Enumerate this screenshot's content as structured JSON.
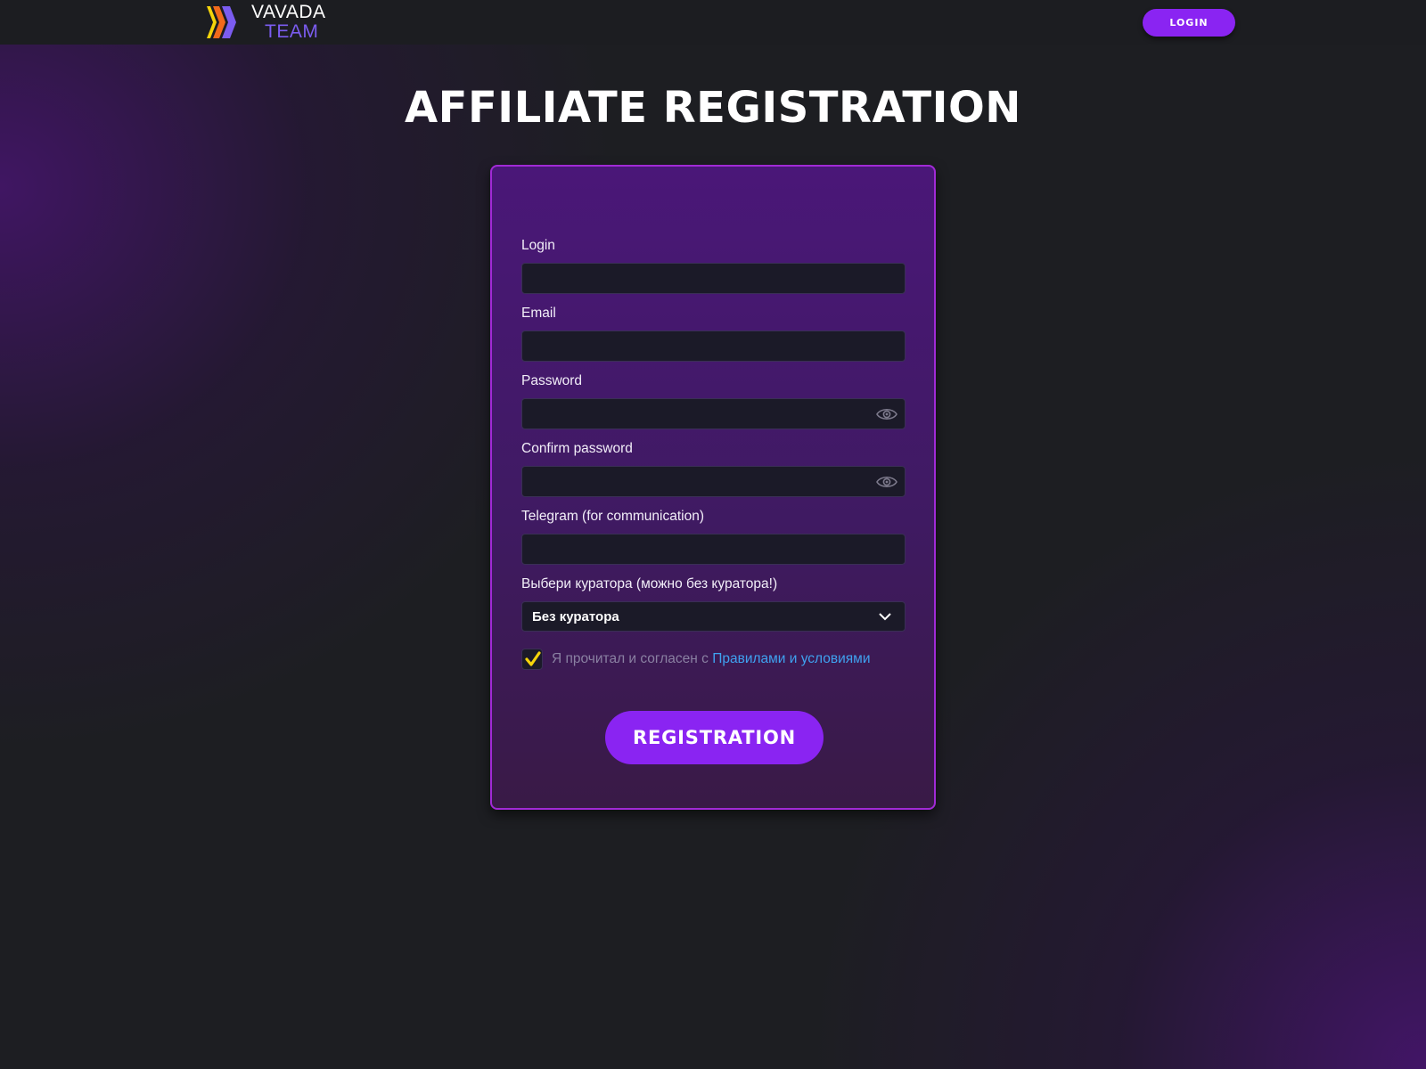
{
  "header": {
    "logo_line1": "VAVADA",
    "logo_line2": "TEAM",
    "login_button": "LOGIN"
  },
  "page": {
    "title": "AFFILIATE REGISTRATION"
  },
  "form": {
    "fields": [
      {
        "label": "Login",
        "value": "",
        "type": "text"
      },
      {
        "label": "Email",
        "value": "",
        "type": "email"
      },
      {
        "label": "Password",
        "value": "",
        "type": "password"
      },
      {
        "label": "Confirm password",
        "value": "",
        "type": "password"
      },
      {
        "label": "Telegram (for communication)",
        "value": "",
        "type": "text"
      }
    ],
    "curator": {
      "label": "Выбери куратора (можно без куратора!)",
      "selected": "Без куратора"
    },
    "terms": {
      "checked": true,
      "text": "Я прочитал и согласен с ",
      "link_text": "Правилами и условиями"
    },
    "submit_label": "REGISTRATION"
  },
  "icons": {
    "logo": "vavada-logo-icon",
    "password_toggle": "eye-icon",
    "dropdown": "chevron-down-icon",
    "checkbox": "check-icon"
  },
  "colors": {
    "accent": "#8a24f2",
    "card_border": "#a12ad6",
    "link": "#3fa2f0",
    "check": "#f5d40a",
    "background": "#1d1e22"
  }
}
